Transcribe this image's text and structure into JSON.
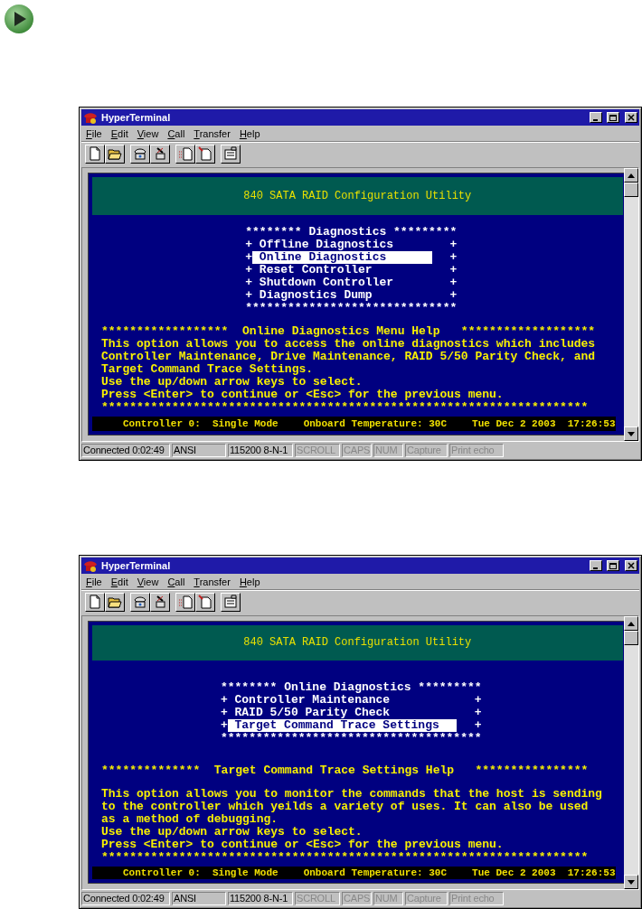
{
  "windows": [
    {
      "title": "HyperTerminal",
      "menu": [
        "File",
        "Edit",
        "View",
        "Call",
        "Transfer",
        "Help"
      ],
      "terminal": {
        "rows": [
          {
            "kind": "banner",
            "text": "840 SATA RAID Configuration Utility"
          },
          {
            "kind": "menu",
            "heading": "******** Diagnostics *********",
            "items": [
              {
                "prefix": "+",
                "label": "Offline Diagnostics",
                "suffix": "+",
                "selected": false
              },
              {
                "prefix": "+",
                "label": "Online Diagnostics",
                "suffix": "+",
                "selected": true
              },
              {
                "prefix": "+",
                "label": "Reset Controller",
                "suffix": "+",
                "selected": false
              },
              {
                "prefix": "+",
                "label": "Shutdown Controller",
                "suffix": "+",
                "selected": false
              },
              {
                "prefix": "+",
                "label": "Diagnostics Dump",
                "suffix": "+",
                "selected": false
              }
            ],
            "footer": "******************************"
          },
          {
            "kind": "blank"
          },
          {
            "kind": "line",
            "text": "******************  Online Diagnostics Menu Help   *******************"
          },
          {
            "kind": "line",
            "text": "This option allows you to access the online diagnostics which includes"
          },
          {
            "kind": "line",
            "text": "Controller Maintenance, Drive Maintenance, RAID 5/50 Parity Check, and"
          },
          {
            "kind": "line",
            "text": "Target Command Trace Settings."
          },
          {
            "kind": "line",
            "text": "Use the up/down arrow keys to select."
          },
          {
            "kind": "line",
            "text": "Press <Enter> to continue or <Esc> for the previous menu."
          },
          {
            "kind": "line",
            "text": "*********************************************************************"
          },
          {
            "kind": "status",
            "controller": "Controller 0:  Single Mode",
            "temperature": "Onboard Temperature: 30C",
            "date": "Tue Dec 2 2003  17:26:53"
          }
        ]
      },
      "status_bar": [
        {
          "text": "Connected 0:02:49",
          "disabled": false
        },
        {
          "text": "ANSI",
          "disabled": false
        },
        {
          "text": "115200 8-N-1",
          "disabled": false
        },
        {
          "text": "SCROLL",
          "disabled": true
        },
        {
          "text": "CAPS",
          "disabled": true
        },
        {
          "text": "NUM",
          "disabled": true
        },
        {
          "text": "Capture",
          "disabled": true
        },
        {
          "text": "Print echo",
          "disabled": true
        }
      ]
    },
    {
      "title": "HyperTerminal",
      "menu": [
        "File",
        "Edit",
        "View",
        "Call",
        "Transfer",
        "Help"
      ],
      "terminal": {
        "rows": [
          {
            "kind": "banner",
            "text": "840 SATA RAID Configuration Utility"
          },
          {
            "kind": "blank"
          },
          {
            "kind": "menu",
            "heading": "******** Online Diagnostics *********",
            "items": [
              {
                "prefix": "+",
                "label": "Controller Maintenance",
                "suffix": "+",
                "selected": false
              },
              {
                "prefix": "+",
                "label": "RAID 5/50 Parity Check",
                "suffix": "+",
                "selected": false
              },
              {
                "prefix": "+",
                "label": "Target Command Trace Settings",
                "suffix": "+",
                "selected": true
              }
            ],
            "footer": "*************************************"
          },
          {
            "kind": "blank"
          },
          {
            "kind": "blank"
          },
          {
            "kind": "line",
            "text": "**************  Target Command Trace Settings Help   ****************"
          },
          {
            "kind": "blank"
          },
          {
            "kind": "line",
            "text": "This option allows you to monitor the commands that the host is sending"
          },
          {
            "kind": "line",
            "text": "to the controller which yeilds a variety of uses. It can also be used"
          },
          {
            "kind": "line",
            "text": "as a method of debugging."
          },
          {
            "kind": "line",
            "text": "Use the up/down arrow keys to select."
          },
          {
            "kind": "line",
            "text": "Press <Enter> to continue or <Esc> for the previous menu."
          },
          {
            "kind": "line",
            "text": "*********************************************************************"
          },
          {
            "kind": "status",
            "controller": "Controller 0:  Single Mode",
            "temperature": "Onboard Temperature: 30C",
            "date": "Tue Dec 2 2003  17:26:53"
          }
        ]
      },
      "status_bar": [
        {
          "text": "Connected 0:02:49",
          "disabled": false
        },
        {
          "text": "ANSI",
          "disabled": false
        },
        {
          "text": "115200 8-N-1",
          "disabled": false
        },
        {
          "text": "SCROLL",
          "disabled": true
        },
        {
          "text": "CAPS",
          "disabled": true
        },
        {
          "text": "NUM",
          "disabled": true
        },
        {
          "text": "Capture",
          "disabled": true
        },
        {
          "text": "Print echo",
          "disabled": true
        }
      ]
    }
  ]
}
